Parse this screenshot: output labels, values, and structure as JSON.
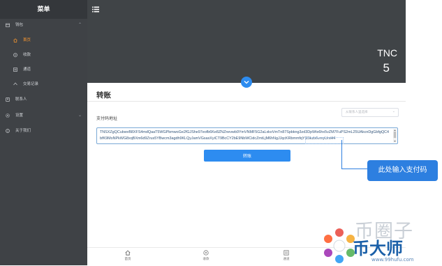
{
  "sidebar": {
    "title": "菜单",
    "items": [
      {
        "label": "钱包",
        "icon": "wallet-icon"
      },
      {
        "label": "首页",
        "icon": "home-icon"
      },
      {
        "label": "收款",
        "icon": "receive-icon"
      },
      {
        "label": "通道",
        "icon": "channel-icon"
      },
      {
        "label": "交易记录",
        "icon": "record-icon"
      },
      {
        "label": "联系人",
        "icon": "contacts-icon"
      },
      {
        "label": "设置",
        "icon": "settings-icon"
      },
      {
        "label": "关于我们",
        "icon": "info-icon"
      }
    ]
  },
  "header": {
    "coin_name": "TNC",
    "balance": "5"
  },
  "transfer": {
    "title": "转账",
    "address_label": "支付码地址",
    "contact_select_placeholder": "从联系人里选择",
    "address_value": "TNSXZgQCubwvB8XFS4mdQaaT5WGPbmwoGe2fGJShe97eofb6Ke8ZNZnevwb9YmVNMF5G2aLxkoVmTn87Spbkng3zd3DpWtx6hx5vZM7FuPS2mL25UAkcnDgGbfgQC4bfK9MoNPkWG8xqBXm6d9Zrus5YBwcm3agdh9KLQyJamVGsaxXyiCT9BcCY2bE9NbWCidcZmtLjM6hNgJJqcKRbmmfqYSSkzb6vmyUmH4",
    "submit_label": "转账"
  },
  "annotation": {
    "callout_text": "此处输入支付码"
  },
  "bottom_nav": [
    {
      "label": "首页",
      "icon": "home-icon"
    },
    {
      "label": "收款",
      "icon": "receive-icon"
    },
    {
      "label": "通道",
      "icon": "channel-icon"
    }
  ],
  "watermark": {
    "line1": "币圈子",
    "line2": "币大师",
    "url": "www.99hufu.com"
  },
  "colors": {
    "sidebar_bg": "#3f4246",
    "header_bg": "#404447",
    "accent": "#2d8cf0",
    "active_menu": "#ff9a2f"
  }
}
